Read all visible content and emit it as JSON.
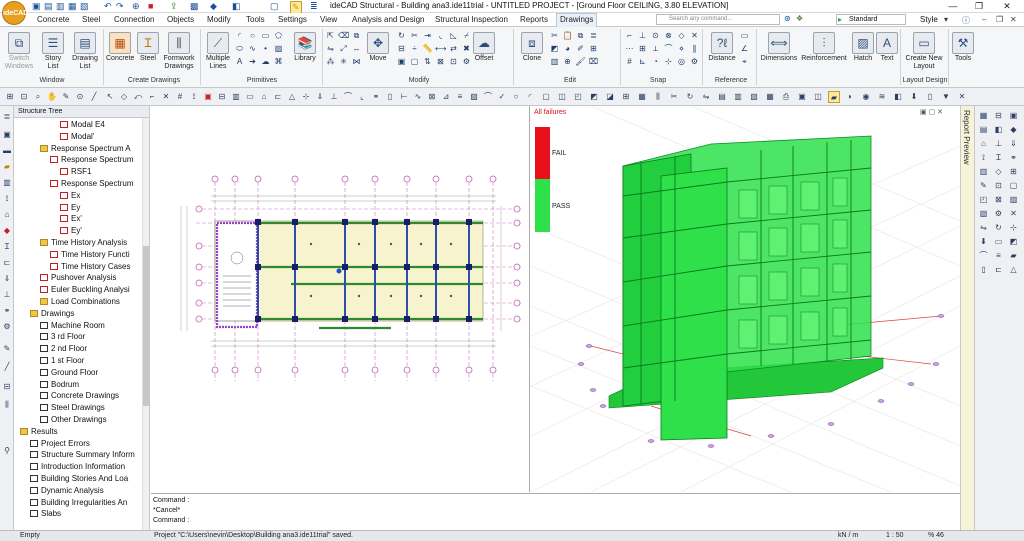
{
  "app": {
    "logo": "ideCAD",
    "title": "ideCAD Structural - Building ana3.ide11trial - UNTITLED PROJECT - [Ground Floor CEILING,  3.80 ELEVATION]"
  },
  "menu": [
    "Concrete",
    "Steel",
    "Connection",
    "Objects",
    "Modify",
    "Tools",
    "Settings",
    "View",
    "Analysis and Design",
    "Structural Inspection",
    "Reports",
    "Drawings"
  ],
  "search": {
    "placeholder": "Search any command..."
  },
  "style_selector": {
    "value": "Standard",
    "style_label": "Style"
  },
  "ribbon": {
    "groups": [
      {
        "label": "Window",
        "buttons": [
          "Switch Windows",
          "Story List",
          "Drawing List"
        ]
      },
      {
        "label": "Create Drawings",
        "buttons": [
          "Concrete",
          "Steel",
          "Formwork Drawings"
        ]
      },
      {
        "label": "Primitives",
        "buttons": [
          "Multiple Lines",
          "Library"
        ]
      },
      {
        "label": "Modify",
        "buttons": [
          "Move",
          "Offset"
        ]
      },
      {
        "label": "Edit",
        "buttons": [
          "Clone"
        ]
      },
      {
        "label": "Snap",
        "buttons": []
      },
      {
        "label": "Reference",
        "buttons": [
          "Distance"
        ]
      },
      {
        "label": "",
        "buttons": [
          "Dimensions",
          "Reinforcement",
          "Hatch",
          "Text"
        ]
      },
      {
        "label": "Layout Design",
        "buttons": [
          "Create New Layout"
        ]
      },
      {
        "label": "",
        "buttons": [
          "Tools"
        ]
      }
    ]
  },
  "tree": {
    "title": "Structure Tree",
    "items": [
      {
        "label": "Modal E4",
        "depth": 4,
        "icon": "modal"
      },
      {
        "label": "Modal'",
        "depth": 4,
        "icon": "modal"
      },
      {
        "label": "Response Spectrum A",
        "depth": 2,
        "icon": "folder"
      },
      {
        "label": "Response Spectrum",
        "depth": 3,
        "icon": "analysis"
      },
      {
        "label": "RSF1",
        "depth": 4,
        "icon": "analysis"
      },
      {
        "label": "Response Spectrum",
        "depth": 3,
        "icon": "analysis"
      },
      {
        "label": "Ex",
        "depth": 4,
        "icon": "analysis"
      },
      {
        "label": "Ey",
        "depth": 4,
        "icon": "analysis"
      },
      {
        "label": "Ex'",
        "depth": 4,
        "icon": "analysis"
      },
      {
        "label": "Ey'",
        "depth": 4,
        "icon": "analysis"
      },
      {
        "label": "Time History Analysis",
        "depth": 2,
        "icon": "folder"
      },
      {
        "label": "Time History Functi",
        "depth": 3,
        "icon": "analysis"
      },
      {
        "label": "Time History Cases",
        "depth": 3,
        "icon": "analysis"
      },
      {
        "label": "Pushover Analysis",
        "depth": 2,
        "icon": "analysis"
      },
      {
        "label": "Euler Buckling Analysi",
        "depth": 2,
        "icon": "analysis"
      },
      {
        "label": "Load Combinations",
        "depth": 2,
        "icon": "folder"
      },
      {
        "label": "Drawings",
        "depth": 1,
        "icon": "folder"
      },
      {
        "label": "Machine Room",
        "depth": 2,
        "icon": "doc"
      },
      {
        "label": "3 rd Floor",
        "depth": 2,
        "icon": "doc"
      },
      {
        "label": "2 nd Floor",
        "depth": 2,
        "icon": "doc"
      },
      {
        "label": "1 st Floor",
        "depth": 2,
        "icon": "doc"
      },
      {
        "label": "Ground Floor",
        "depth": 2,
        "icon": "doc"
      },
      {
        "label": "Bodrum",
        "depth": 2,
        "icon": "doc"
      },
      {
        "label": "Concrete Drawings",
        "depth": 2,
        "icon": "pin"
      },
      {
        "label": "Steel Drawings",
        "depth": 2,
        "icon": "pin"
      },
      {
        "label": "Other Drawings",
        "depth": 2,
        "icon": "pin"
      },
      {
        "label": "Results",
        "depth": 0,
        "icon": "folder"
      },
      {
        "label": "Project Errors",
        "depth": 1,
        "icon": "doc"
      },
      {
        "label": "Structure Summary Inform",
        "depth": 1,
        "icon": "doc"
      },
      {
        "label": "Introduction Information",
        "depth": 1,
        "icon": "doc"
      },
      {
        "label": "Building Stories And Loa",
        "depth": 1,
        "icon": "doc"
      },
      {
        "label": "Dynamic Analysis",
        "depth": 1,
        "icon": "doc"
      },
      {
        "label": "Building Irregularities An",
        "depth": 1,
        "icon": "doc"
      },
      {
        "label": "Slabs",
        "depth": 1,
        "icon": "doc"
      }
    ]
  },
  "view3d": {
    "legend_title": "All failures",
    "fail_label": "FAIL",
    "pass_label": "PASS",
    "fail_color": "#e8101a",
    "pass_color": "#2ee04a"
  },
  "command": {
    "lines": [
      "Command :",
      "*Cancel*",
      "Command :"
    ]
  },
  "right_panel": {
    "label": "Report Preview"
  },
  "status": {
    "left": "Empty",
    "message": "Project \"C:\\Users\\nevin\\Desktop\\Building ana3.ide11trial\" saved.",
    "units": "kN / m",
    "scale": "1 : 50",
    "zoom": "% 46"
  }
}
